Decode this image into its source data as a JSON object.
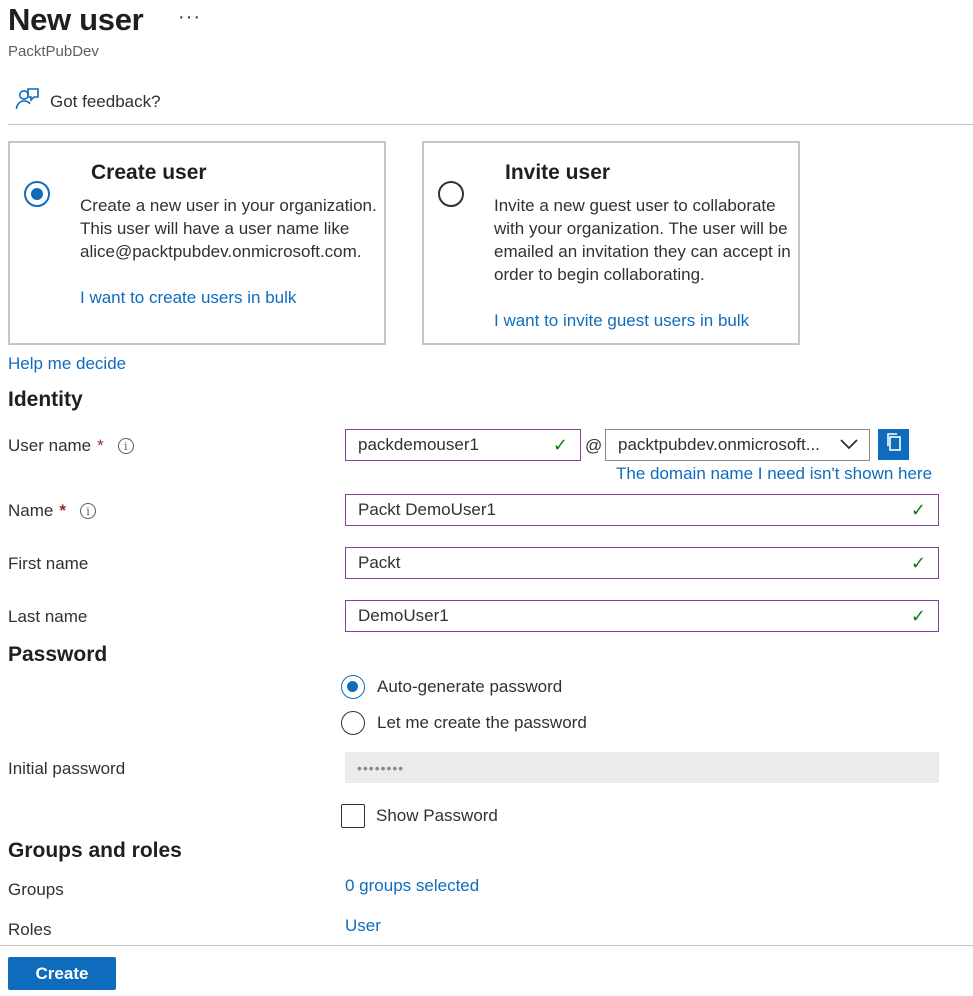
{
  "header": {
    "title": "New user",
    "more": "···",
    "subtitle": "PacktPubDev",
    "feedback": "Got feedback?"
  },
  "cards": {
    "create": {
      "title": "Create user",
      "desc": "Create a new user in your organization. This user will have a user name like alice@packtpubdev.onmicrosoft.com.",
      "link": "I want to create users in bulk",
      "selected": true
    },
    "invite": {
      "title": "Invite user",
      "desc": "Invite a new guest user to collaborate with your organization. The user will be emailed an invitation they can accept in order to begin collaborating.",
      "link": "I want to invite guest users in bulk",
      "selected": false
    }
  },
  "help_link": "Help me decide",
  "identity": {
    "heading": "Identity",
    "username_label": "User name",
    "username_value": "packdemouser1",
    "at": "@",
    "domain_value": "packtpubdev.onmicrosoft...",
    "domain_link": "The domain name I need isn't shown here",
    "name_label": "Name",
    "name_value": "Packt DemoUser1",
    "first_label": "First name",
    "first_value": "Packt",
    "last_label": "Last name",
    "last_value": "DemoUser1",
    "required_mark": "*"
  },
  "password": {
    "heading": "Password",
    "auto_label": "Auto-generate password",
    "manual_label": "Let me create the password",
    "selected": "auto",
    "initial_label": "Initial password",
    "initial_value": "••••••••",
    "show_label": "Show Password"
  },
  "groups": {
    "heading": "Groups and roles",
    "groups_label": "Groups",
    "groups_value": "0 groups selected",
    "roles_label": "Roles",
    "roles_value": "User"
  },
  "footer": {
    "create_label": "Create"
  },
  "colors": {
    "accent": "#0f6cbd",
    "valid_border": "#8a3fa0",
    "check": "#107c10",
    "required": "#a4262c"
  }
}
